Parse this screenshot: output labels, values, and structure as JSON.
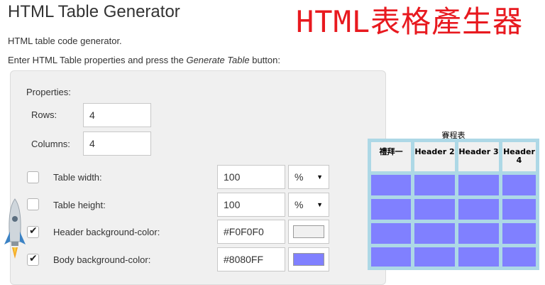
{
  "header": {
    "title": "HTML Table Generator",
    "banner": "HTML表格產生器",
    "subtitle": "HTML table code generator.",
    "instruction_prefix": "Enter HTML Table properties and press the ",
    "instruction_em": "Generate Table",
    "instruction_suffix": " button:"
  },
  "properties": {
    "heading": "Properties:",
    "rows": {
      "label": "Rows:",
      "value": "4"
    },
    "columns": {
      "label": "Columns:",
      "value": "4"
    },
    "options": [
      {
        "label": "Table width:",
        "checked": false,
        "value": "100",
        "unit": "%"
      },
      {
        "label": "Table height:",
        "checked": false,
        "value": "100",
        "unit": "%"
      },
      {
        "label": "Header background-color:",
        "checked": true,
        "value": "#F0F0F0",
        "swatch": "#F0F0F0"
      },
      {
        "label": "Body background-color:",
        "checked": true,
        "value": "#8080FF",
        "swatch": "#8080FF"
      }
    ]
  },
  "preview": {
    "caption": "賽程表",
    "headers": [
      "禮拜一",
      "Header 2",
      "Header 3",
      "Header 4"
    ],
    "border_color": "#ADD8E6",
    "header_bg": "#F0F0F0",
    "body_bg": "#8080FF"
  },
  "icons": {
    "rocket": "rocket-icon",
    "caret": "caret-down-icon",
    "check": "check-icon"
  }
}
